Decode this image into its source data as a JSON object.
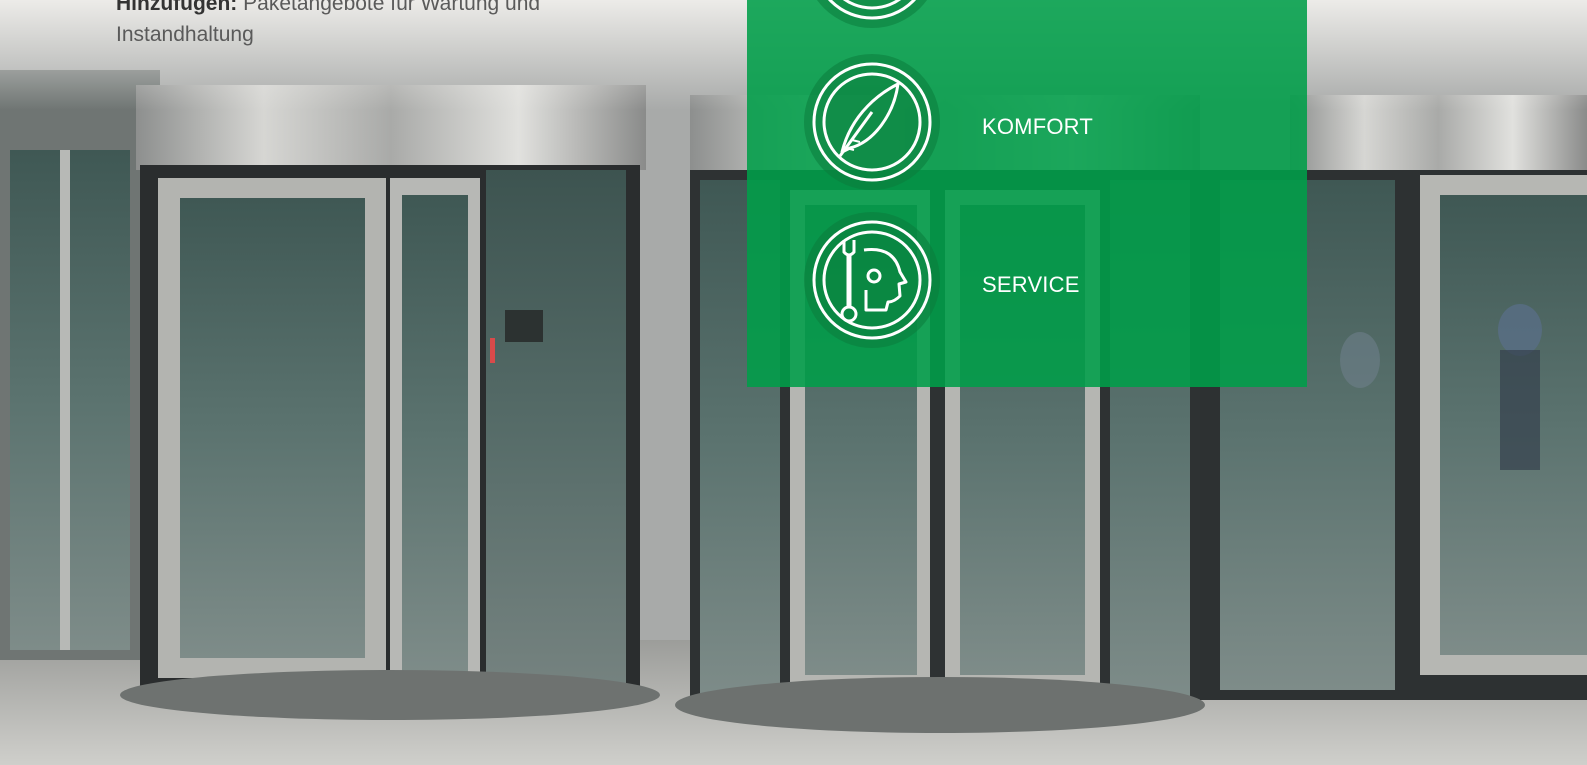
{
  "intro": {
    "bold": "Hinzufügen:",
    "text": " Paketangebote für Wartung und Instandhaltung"
  },
  "features": [
    {
      "icon": "clock-icon",
      "label": ""
    },
    {
      "icon": "feather-icon",
      "label": "KOMFORT"
    },
    {
      "icon": "wrench-service-icon",
      "label": "SERVICE"
    }
  ],
  "colors": {
    "accent": "#009E49"
  }
}
